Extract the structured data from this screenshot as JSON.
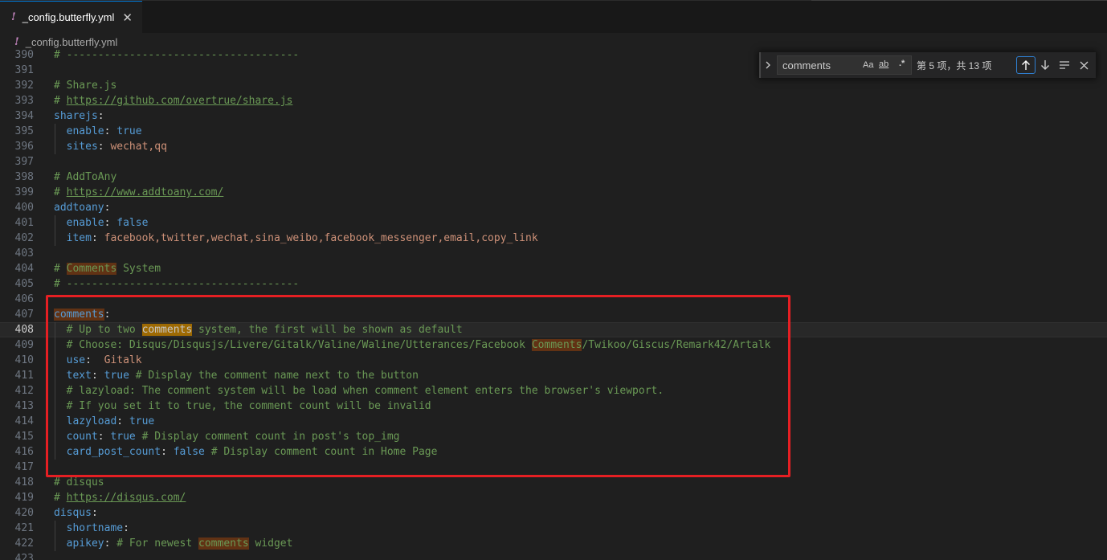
{
  "tab": {
    "filename": "_config.butterfly.yml",
    "close_glyph": "✕"
  },
  "breadcrumb": {
    "filename": "_config.butterfly.yml"
  },
  "icons": {
    "yaml": "!",
    "expand": "chevron-right-icon",
    "prev": "arrow-up-icon",
    "next": "arrow-down-icon",
    "selection": "lines-icon",
    "close": "close-icon"
  },
  "find": {
    "query": "comments",
    "match_case": "Aa",
    "whole_word": "ab",
    "regex": ".*",
    "result": "第 5 项，共 13 项"
  },
  "editor": {
    "current_line": "408",
    "lines": [
      {
        "n": "390",
        "t": "# -------------------------------------"
      },
      {
        "n": "391",
        "t": ""
      },
      {
        "n": "392",
        "t": "# Share.js"
      },
      {
        "n": "393",
        "t": "# https://github.com/overtrue/share.js"
      },
      {
        "n": "394",
        "t": "sharejs:"
      },
      {
        "n": "395",
        "t": "  enable: true"
      },
      {
        "n": "396",
        "t": "  sites: wechat,qq"
      },
      {
        "n": "397",
        "t": ""
      },
      {
        "n": "398",
        "t": "# AddToAny"
      },
      {
        "n": "399",
        "t": "# https://www.addtoany.com/"
      },
      {
        "n": "400",
        "t": "addtoany:"
      },
      {
        "n": "401",
        "t": "  enable: false"
      },
      {
        "n": "402",
        "t": "  item: facebook,twitter,wechat,sina_weibo,facebook_messenger,email,copy_link"
      },
      {
        "n": "403",
        "t": ""
      },
      {
        "n": "404",
        "t": "# Comments System"
      },
      {
        "n": "405",
        "t": "# -------------------------------------"
      },
      {
        "n": "406",
        "t": ""
      },
      {
        "n": "407",
        "t": "comments:"
      },
      {
        "n": "408",
        "t": "  # Up to two comments system, the first will be shown as default"
      },
      {
        "n": "409",
        "t": "  # Choose: Disqus/Disqusjs/Livere/Gitalk/Valine/Waline/Utterances/Facebook Comments/Twikoo/Giscus/Remark42/Artalk"
      },
      {
        "n": "410",
        "t": "  use:  Gitalk"
      },
      {
        "n": "411",
        "t": "  text: true # Display the comment name next to the button"
      },
      {
        "n": "412",
        "t": "  # lazyload: The comment system will be load when comment element enters the browser's viewport."
      },
      {
        "n": "413",
        "t": "  # If you set it to true, the comment count will be invalid"
      },
      {
        "n": "414",
        "t": "  lazyload: true"
      },
      {
        "n": "415",
        "t": "  count: true # Display comment count in post's top_img"
      },
      {
        "n": "416",
        "t": "  card_post_count: false # Display comment count in Home Page"
      },
      {
        "n": "417",
        "t": ""
      },
      {
        "n": "418",
        "t": "# disqus"
      },
      {
        "n": "419",
        "t": "# https://disqus.com/"
      },
      {
        "n": "420",
        "t": "disqus:"
      },
      {
        "n": "421",
        "t": "  shortname:"
      },
      {
        "n": "422",
        "t": "  apikey: # For newest comments widget"
      },
      {
        "n": "423",
        "t": ""
      }
    ]
  }
}
